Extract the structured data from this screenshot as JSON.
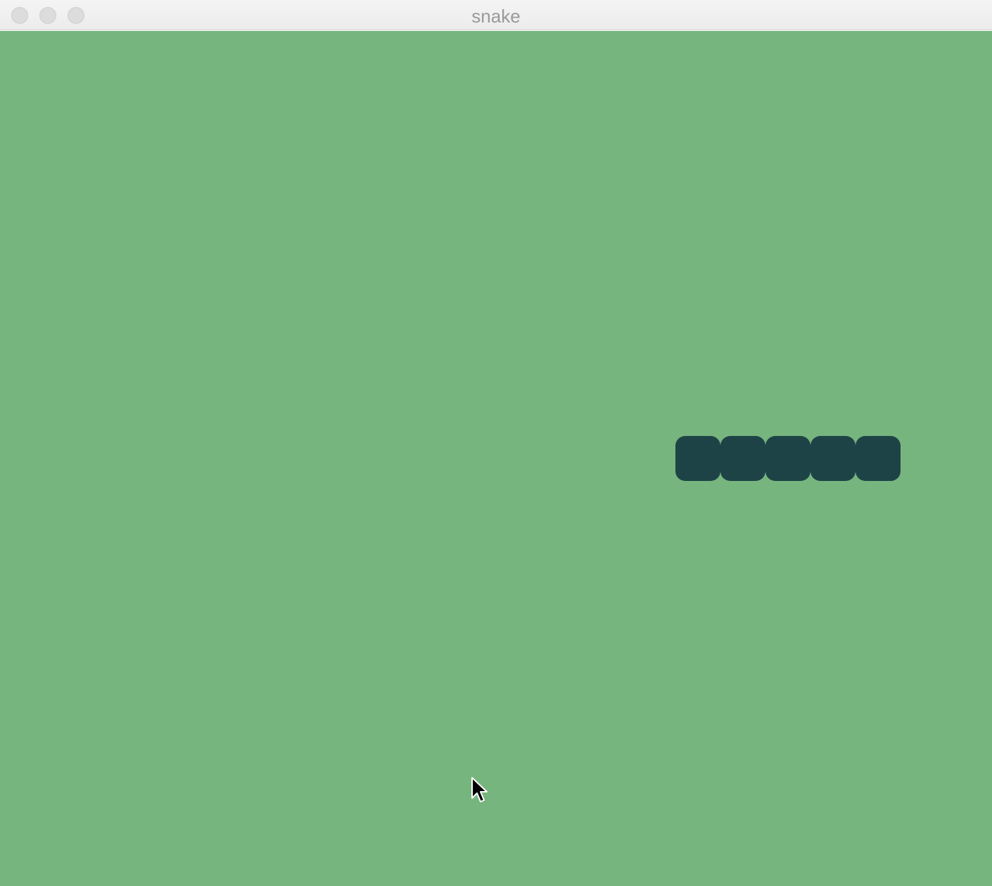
{
  "window": {
    "title": "snake"
  },
  "game": {
    "board_color": "#77b57e",
    "snake_color": "#1e4347",
    "snake_length": 5,
    "snake_cells": [
      {
        "col": 0
      },
      {
        "col": 1
      },
      {
        "col": 2
      },
      {
        "col": 3
      },
      {
        "col": 4
      }
    ]
  },
  "icons": {
    "close": "close-button-circle",
    "minimize": "minimize-button-circle",
    "zoom": "zoom-button-circle",
    "cursor": "mouse-pointer-icon"
  }
}
